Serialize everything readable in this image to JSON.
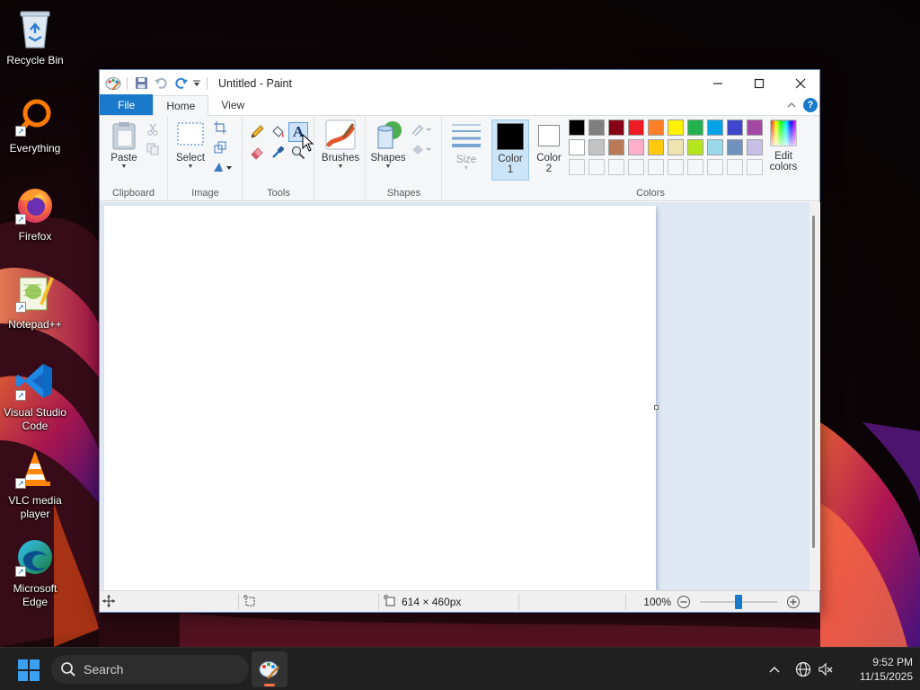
{
  "desktop": {
    "icons": [
      {
        "label": "Recycle Bin",
        "icon": "recycle-bin-icon"
      },
      {
        "label": "Everything",
        "icon": "everything-search-icon"
      },
      {
        "label": "Firefox",
        "icon": "firefox-icon"
      },
      {
        "label": "Notepad++",
        "icon": "notepadpp-icon"
      },
      {
        "label": "Visual Studio Code",
        "icon": "vscode-icon"
      },
      {
        "label": "VLC media player",
        "icon": "vlc-icon"
      },
      {
        "label": "Microsoft Edge",
        "icon": "edge-icon"
      }
    ]
  },
  "paint": {
    "title": "Untitled - Paint",
    "tabs": {
      "file": "File",
      "home": "Home",
      "view": "View"
    },
    "groups": {
      "clipboard": "Clipboard",
      "image": "Image",
      "tools": "Tools",
      "shapes": "Shapes",
      "colors": "Colors"
    },
    "buttons": {
      "paste": "Paste",
      "select": "Select",
      "brushes": "Brushes",
      "shapes": "Shapes",
      "size": "Size",
      "color1_a": "Color",
      "color1_b": "1",
      "color2_a": "Color",
      "color2_b": "2",
      "edit_colors_a": "Edit",
      "edit_colors_b": "colors"
    },
    "color1": "#000000",
    "color2": "#ffffff",
    "palette_row1": [
      "#000000",
      "#7f7f7f",
      "#880015",
      "#ed1c24",
      "#ff7f27",
      "#fff200",
      "#22b14c",
      "#00a2e8",
      "#3f48cc",
      "#a349a4"
    ],
    "palette_row2": [
      "#ffffff",
      "#c3c3c3",
      "#b97a57",
      "#ffaec9",
      "#ffc90e",
      "#efe4b0",
      "#b5e61d",
      "#99d9ea",
      "#7092be",
      "#c8bfe7"
    ],
    "status": {
      "image_size": "614 × 460px",
      "zoom": "100%",
      "zoom_fraction": 0.5
    }
  },
  "taskbar": {
    "search_placeholder": "Search",
    "time": "9:52 PM",
    "date": "11/15/2025"
  }
}
